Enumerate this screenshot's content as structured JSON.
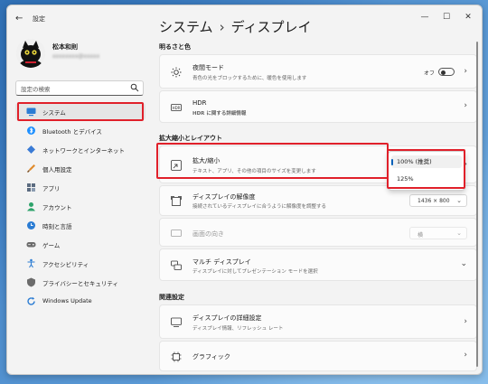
{
  "window": {
    "title": "設定"
  },
  "user": {
    "name": "松本和則",
    "email": "xxxxxxxx@xxxxx"
  },
  "search": {
    "placeholder": "設定の検索"
  },
  "sidebar": {
    "items": [
      {
        "label": "システム",
        "icon": "display-icon",
        "color": "#2b7cd3"
      },
      {
        "label": "Bluetooth とデバイス",
        "icon": "bluetooth-icon",
        "color": "#1e90ff"
      },
      {
        "label": "ネットワークとインターネット",
        "icon": "network-icon",
        "color": "#3a7bd5"
      },
      {
        "label": "個人用設定",
        "icon": "brush-icon",
        "color": "#e08a2b"
      },
      {
        "label": "アプリ",
        "icon": "apps-icon",
        "color": "#5b6b80"
      },
      {
        "label": "アカウント",
        "icon": "account-icon",
        "color": "#2ea36b"
      },
      {
        "label": "時刻と言語",
        "icon": "globe-clock-icon",
        "color": "#2b7cd3"
      },
      {
        "label": "ゲーム",
        "icon": "gamepad-icon",
        "color": "#6b6b6b"
      },
      {
        "label": "アクセシビリティ",
        "icon": "accessibility-icon",
        "color": "#2b7cd3"
      },
      {
        "label": "プライバシーとセキュリティ",
        "icon": "shield-icon",
        "color": "#6b6b6b"
      },
      {
        "label": "Windows Update",
        "icon": "update-icon",
        "color": "#2b7cd3"
      }
    ]
  },
  "breadcrumb": {
    "parent": "システム",
    "separator": "›",
    "current": "ディスプレイ"
  },
  "sections": {
    "brightness": "明るさと色",
    "scale_layout": "拡大縮小とレイアウト",
    "related": "関連設定"
  },
  "night_light": {
    "title": "夜間モード",
    "subtitle": "青色の光をブロックするために、暖色を使用します",
    "state": "オフ"
  },
  "hdr": {
    "title": "HDR",
    "link": "HDR に関する詳細情報"
  },
  "scale": {
    "title": "拡大/縮小",
    "subtitle": "テキスト、アプリ、その他の項目のサイズを変更します"
  },
  "scale_options": [
    "100% (推奨)",
    "125%"
  ],
  "resolution": {
    "title": "ディスプレイの解像度",
    "subtitle": "接続されているディスプレイに合うように解像度を調整する",
    "value": "1436 × 800"
  },
  "orientation": {
    "title": "画面の向き",
    "value": "横"
  },
  "multi_display": {
    "title": "マルチ ディスプレイ",
    "subtitle": "ディスプレイに対してプレゼンテーション モードを選択"
  },
  "advanced_display": {
    "title": "ディスプレイの詳細設定",
    "subtitle": "ディスプレイ情報、リフレッシュ レート"
  },
  "graphics": {
    "title": "グラフィック"
  },
  "colors": {
    "accent": "#005fb8",
    "highlight": "#e0202a"
  }
}
